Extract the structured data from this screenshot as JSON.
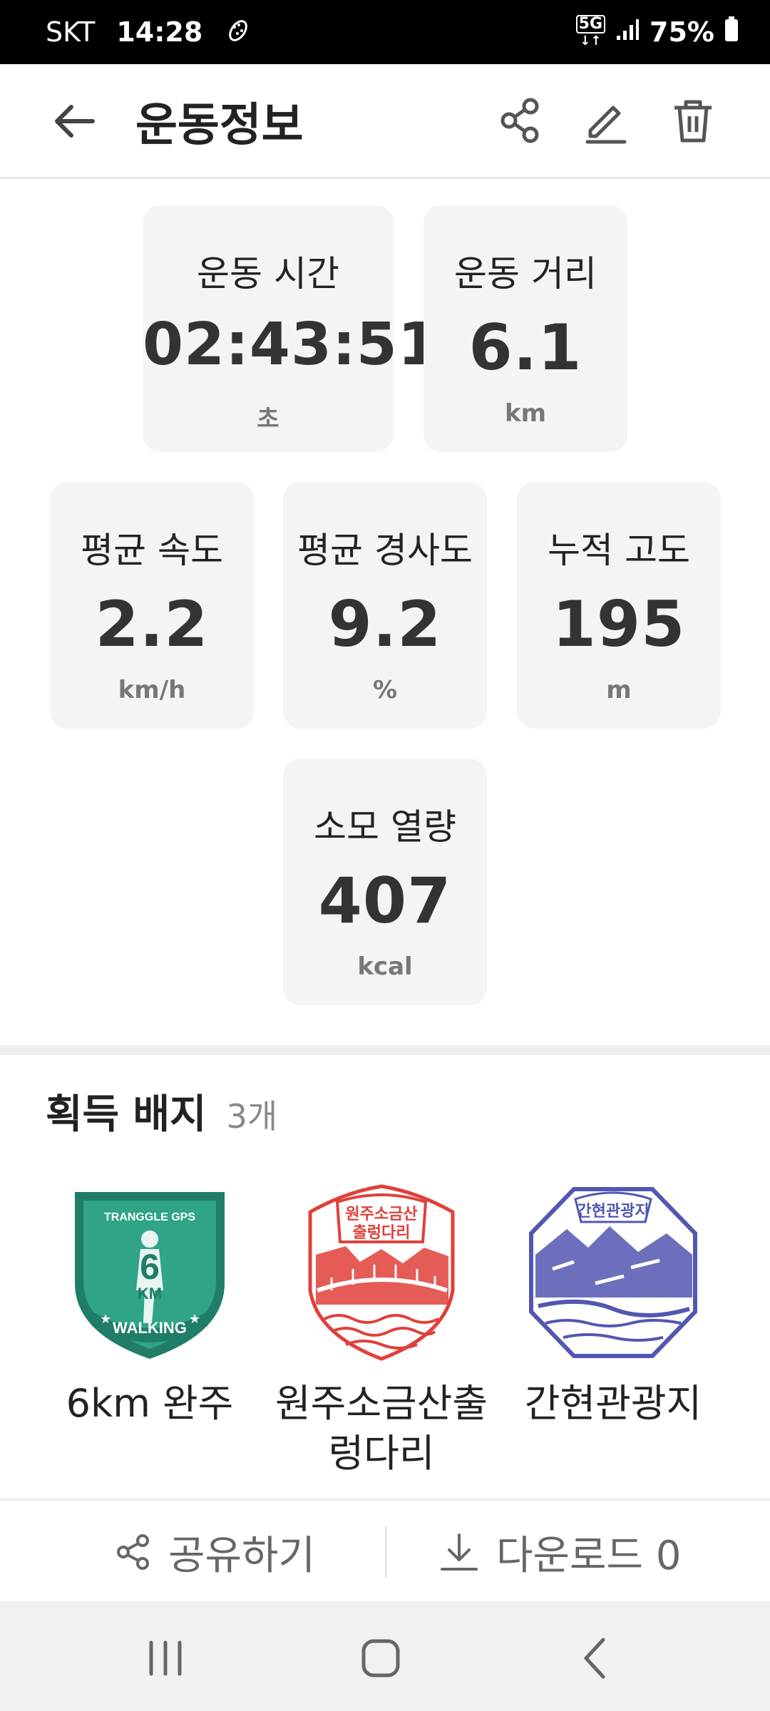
{
  "status_bar": {
    "carrier": "SKT",
    "time": "14:28",
    "network": "5G",
    "battery": "75%"
  },
  "header": {
    "title": "운동정보",
    "icons": [
      "back-arrow-icon",
      "share-icon",
      "edit-icon",
      "delete-icon"
    ]
  },
  "stats": {
    "duration": {
      "label": "운동 시간",
      "value": "02:43:51",
      "unit": "초"
    },
    "distance": {
      "label": "운동 거리",
      "value": "6.1",
      "unit": "km"
    },
    "avg_speed": {
      "label": "평균 속도",
      "value": "2.2",
      "unit": "km/h"
    },
    "avg_slope": {
      "label": "평균 경사도",
      "value": "9.2",
      "unit": "%"
    },
    "elevation": {
      "label": "누적 고도",
      "value": "195",
      "unit": "m"
    },
    "calories": {
      "label": "소모 열량",
      "value": "407",
      "unit": "kcal"
    }
  },
  "badges": {
    "title": "획득 배지",
    "count": "3개",
    "items": [
      {
        "name": "6km 완주",
        "line2": "",
        "icon": "walking-6km-badge",
        "color": "#2e9a80",
        "text": [
          "TRANGGLE GPS",
          "6",
          "KM",
          "WALKING"
        ]
      },
      {
        "name": "원주소금산출",
        "line2": "렁다리",
        "icon": "suspension-bridge-stamp",
        "color": "#e0403a",
        "text": [
          "원주소금산",
          "출렁다리"
        ]
      },
      {
        "name": "간현관광지",
        "line2": "",
        "icon": "mountain-river-stamp",
        "color": "#5257b0",
        "text": [
          "간현관광지"
        ]
      }
    ]
  },
  "actions": {
    "share_label": "공유하기",
    "download_label": "다운로드 0"
  },
  "nav": {
    "icons": [
      "recent-apps-icon",
      "home-icon",
      "back-icon"
    ]
  }
}
